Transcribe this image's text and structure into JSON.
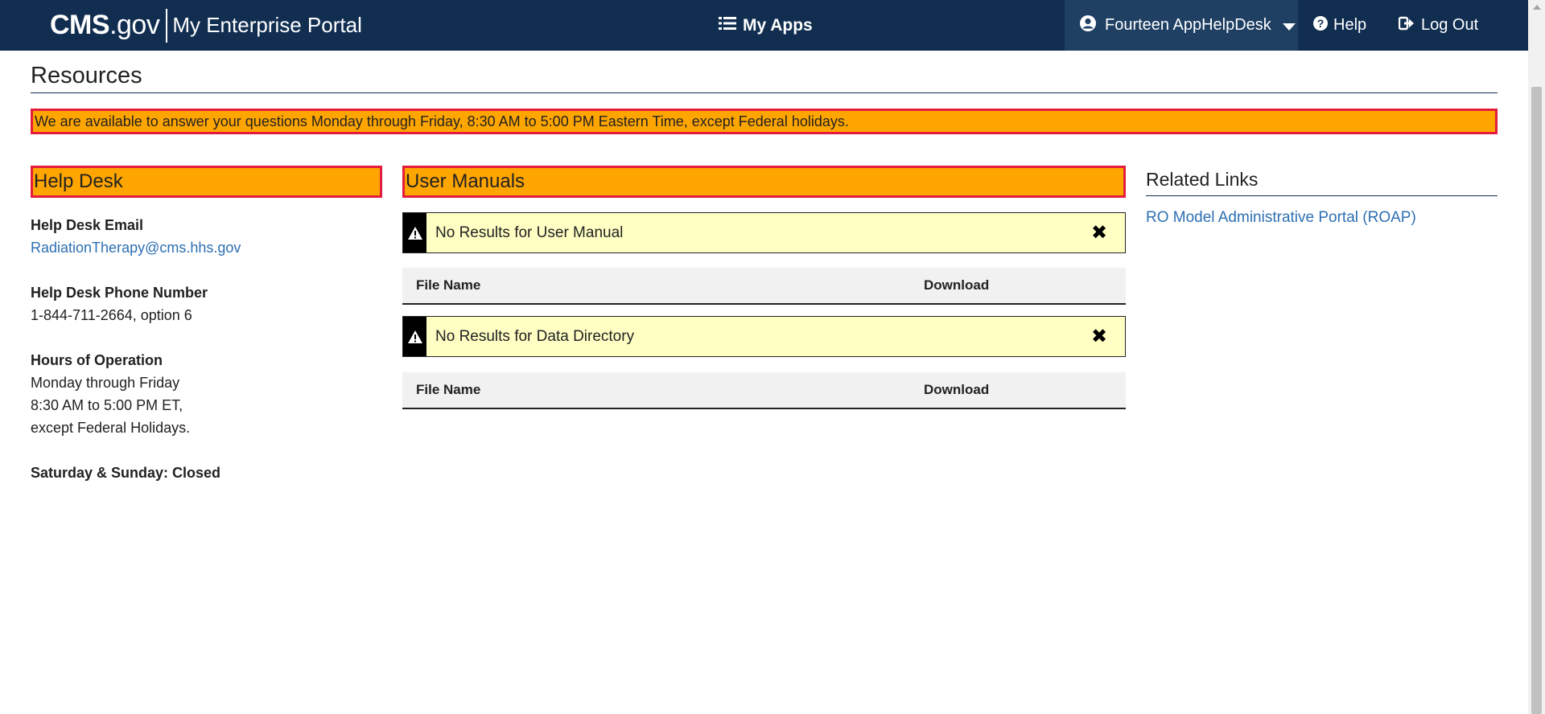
{
  "header": {
    "brand_cms": "CMS",
    "brand_gov": ".gov",
    "portal_name": "My Enterprise Portal",
    "my_apps_label": "My Apps",
    "user_name": "Fourteen AppHelpDesk",
    "help_label": "Help",
    "logout_label": "Log Out"
  },
  "page": {
    "title": "Resources",
    "hours_banner": "We are available to answer your questions Monday through Friday, 8:30 AM to 5:00 PM Eastern Time, except Federal holidays."
  },
  "help_desk": {
    "heading": "Help Desk",
    "email_label": "Help Desk Email",
    "email_value": "RadiationTherapy@cms.hhs.gov",
    "phone_label": "Help Desk Phone Number",
    "phone_value": "1-844-711-2664, option 6",
    "hours_label": "Hours of Operation",
    "hours_line1": "Monday through Friday",
    "hours_line2": "8:30 AM to 5:00 PM ET,",
    "hours_line3": "except Federal Holidays.",
    "weekend": "Saturday & Sunday: Closed"
  },
  "user_manuals": {
    "heading": "User Manuals",
    "alert1_text": "No Results for User Manual",
    "alert2_text": "No Results for Data Directory",
    "table_col_file": "File Name",
    "table_col_download": "Download"
  },
  "related_links": {
    "heading": "Related Links",
    "items": [
      {
        "label": "RO Model Administrative Portal (ROAP)"
      }
    ]
  },
  "colors": {
    "nav_bg": "#112e51",
    "nav_user_bg": "#1f3f63",
    "highlight_orange": "#ffa500",
    "highlight_border_red": "#e31c3d",
    "alert_bg": "#ffffc4",
    "link_blue": "#2c6fb3"
  },
  "icons": {
    "my_apps": "list-icon",
    "user": "user-circle-icon",
    "help": "question-circle-icon",
    "logout": "sign-out-icon",
    "alert": "warning-triangle-icon",
    "close": "close-x-icon"
  }
}
